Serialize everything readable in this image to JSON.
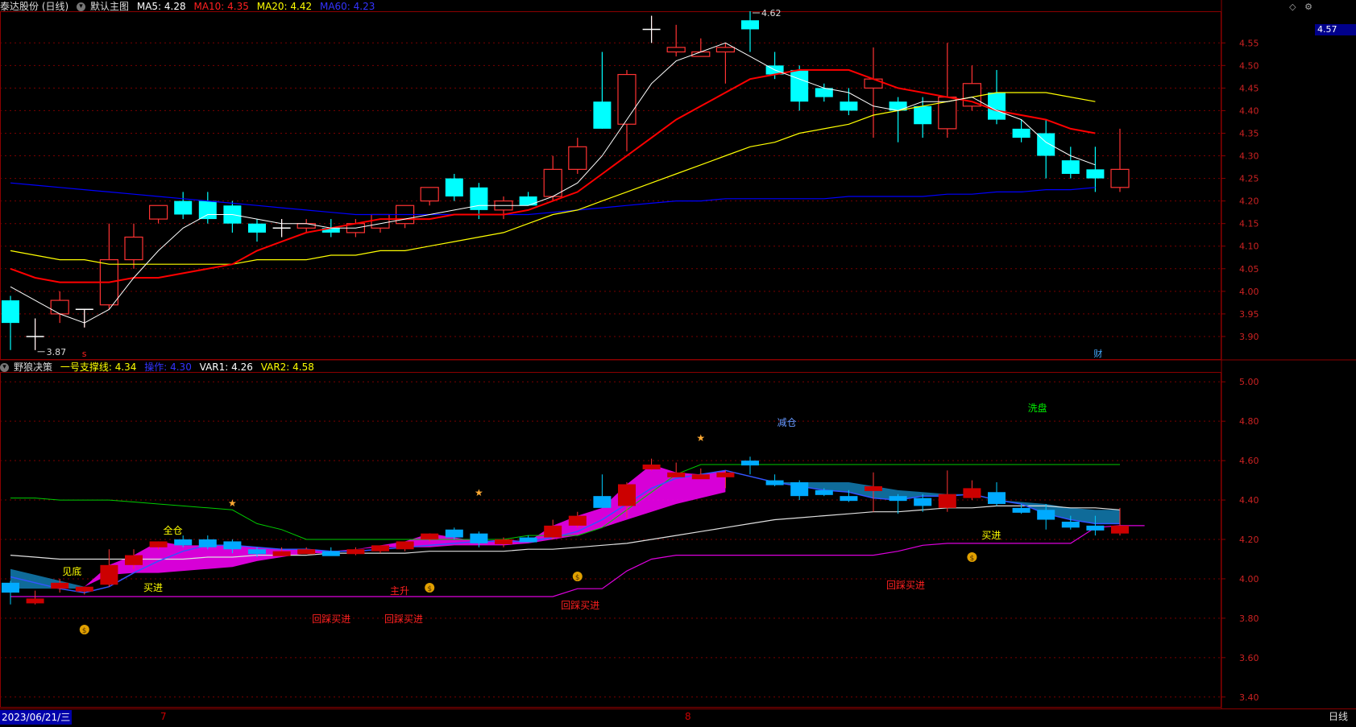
{
  "main_header": {
    "stock": "泰达股份 (日线)",
    "indicator": "默认主图",
    "ma5": "MA5: 4.28",
    "ma10": "MA10: 4.35",
    "ma20": "MA20: 4.42",
    "ma60": "MA60: 4.23"
  },
  "sub_header": {
    "indicator": "野狼决策",
    "support": "一号支撑线: 4.34",
    "op": "操作: 4.30",
    "var1": "VAR1: 4.26",
    "var2": "VAR2: 4.58"
  },
  "current_price_badge": "4.57",
  "high_label": "4.62",
  "low_label": "3.87",
  "marker_s": "s",
  "marker_cai": "财",
  "bottom": {
    "date": "2023/06/21/三",
    "month7": "7",
    "month8": "8",
    "period": "日线"
  },
  "colors": {
    "up": "#ff3333",
    "down": "#00ffff",
    "ma5": "#ffffff",
    "ma10": "#ff0000",
    "ma20": "#ffff00",
    "ma60": "#0000ff",
    "border": "#8b0000"
  },
  "chart_data": [
    {
      "type": "candlestick",
      "name": "main",
      "ylim": [
        3.85,
        4.62
      ],
      "y_ticks": [
        "4.55",
        "4.50",
        "4.45",
        "4.40",
        "4.35",
        "4.30",
        "4.25",
        "4.20",
        "4.15",
        "4.10",
        "4.05",
        "4.00",
        "3.95",
        "3.90"
      ],
      "candles": [
        {
          "o": 3.98,
          "h": 3.99,
          "l": 3.87,
          "c": 3.93
        },
        {
          "o": 3.9,
          "h": 3.94,
          "l": 3.87,
          "c": 3.9
        },
        {
          "o": 3.95,
          "h": 4.0,
          "l": 3.93,
          "c": 3.98
        },
        {
          "o": 3.96,
          "h": 3.96,
          "l": 3.92,
          "c": 3.96
        },
        {
          "o": 3.97,
          "h": 4.15,
          "l": 3.96,
          "c": 4.07
        },
        {
          "o": 4.07,
          "h": 4.15,
          "l": 4.05,
          "c": 4.12
        },
        {
          "o": 4.16,
          "h": 4.19,
          "l": 4.15,
          "c": 4.19
        },
        {
          "o": 4.2,
          "h": 4.22,
          "l": 4.16,
          "c": 4.17
        },
        {
          "o": 4.2,
          "h": 4.22,
          "l": 4.15,
          "c": 4.16
        },
        {
          "o": 4.19,
          "h": 4.2,
          "l": 4.13,
          "c": 4.15
        },
        {
          "o": 4.15,
          "h": 4.16,
          "l": 4.11,
          "c": 4.13
        },
        {
          "o": 4.14,
          "h": 4.16,
          "l": 4.12,
          "c": 4.14
        },
        {
          "o": 4.14,
          "h": 4.16,
          "l": 4.13,
          "c": 4.15
        },
        {
          "o": 4.14,
          "h": 4.16,
          "l": 4.12,
          "c": 4.13
        },
        {
          "o": 4.13,
          "h": 4.16,
          "l": 4.12,
          "c": 4.15
        },
        {
          "o": 4.14,
          "h": 4.17,
          "l": 4.13,
          "c": 4.17
        },
        {
          "o": 4.15,
          "h": 4.19,
          "l": 4.14,
          "c": 4.19
        },
        {
          "o": 4.2,
          "h": 4.23,
          "l": 4.19,
          "c": 4.23
        },
        {
          "o": 4.25,
          "h": 4.26,
          "l": 4.2,
          "c": 4.21
        },
        {
          "o": 4.23,
          "h": 4.24,
          "l": 4.16,
          "c": 4.18
        },
        {
          "o": 4.18,
          "h": 4.21,
          "l": 4.16,
          "c": 4.2
        },
        {
          "o": 4.21,
          "h": 4.22,
          "l": 4.19,
          "c": 4.19
        },
        {
          "o": 4.21,
          "h": 4.3,
          "l": 4.2,
          "c": 4.27
        },
        {
          "o": 4.27,
          "h": 4.34,
          "l": 4.26,
          "c": 4.32
        },
        {
          "o": 4.42,
          "h": 4.53,
          "l": 4.36,
          "c": 4.36
        },
        {
          "o": 4.37,
          "h": 4.49,
          "l": 4.31,
          "c": 4.48
        },
        {
          "o": 4.58,
          "h": 4.61,
          "l": 4.55,
          "c": 4.58
        },
        {
          "o": 4.53,
          "h": 4.59,
          "l": 4.52,
          "c": 4.54
        },
        {
          "o": 4.52,
          "h": 4.56,
          "l": 4.52,
          "c": 4.53
        },
        {
          "o": 4.53,
          "h": 4.55,
          "l": 4.46,
          "c": 4.54
        },
        {
          "o": 4.6,
          "h": 4.62,
          "l": 4.53,
          "c": 4.58
        },
        {
          "o": 4.5,
          "h": 4.53,
          "l": 4.47,
          "c": 4.48
        },
        {
          "o": 4.49,
          "h": 4.5,
          "l": 4.4,
          "c": 4.42
        },
        {
          "o": 4.45,
          "h": 4.46,
          "l": 4.42,
          "c": 4.43
        },
        {
          "o": 4.42,
          "h": 4.45,
          "l": 4.39,
          "c": 4.4
        },
        {
          "o": 4.45,
          "h": 4.54,
          "l": 4.34,
          "c": 4.47
        },
        {
          "o": 4.42,
          "h": 4.43,
          "l": 4.33,
          "c": 4.4
        },
        {
          "o": 4.41,
          "h": 4.43,
          "l": 4.34,
          "c": 4.37
        },
        {
          "o": 4.36,
          "h": 4.55,
          "l": 4.34,
          "c": 4.43
        },
        {
          "o": 4.41,
          "h": 4.5,
          "l": 4.4,
          "c": 4.46
        },
        {
          "o": 4.44,
          "h": 4.49,
          "l": 4.37,
          "c": 4.38
        },
        {
          "o": 4.36,
          "h": 4.38,
          "l": 4.33,
          "c": 4.34
        },
        {
          "o": 4.35,
          "h": 4.38,
          "l": 4.25,
          "c": 4.3
        },
        {
          "o": 4.29,
          "h": 4.32,
          "l": 4.25,
          "c": 4.26
        },
        {
          "o": 4.27,
          "h": 4.32,
          "l": 4.22,
          "c": 4.25
        },
        {
          "o": 4.23,
          "h": 4.36,
          "l": 4.22,
          "c": 4.27
        }
      ],
      "ma5": [
        4.01,
        3.98,
        3.95,
        3.93,
        3.96,
        4.03,
        4.09,
        4.14,
        4.17,
        4.17,
        4.16,
        4.15,
        4.15,
        4.14,
        4.14,
        4.15,
        4.16,
        4.17,
        4.18,
        4.19,
        4.19,
        4.19,
        4.21,
        4.24,
        4.3,
        4.38,
        4.46,
        4.51,
        4.53,
        4.55,
        4.52,
        4.49,
        4.47,
        4.45,
        4.44,
        4.41,
        4.4,
        4.42,
        4.42,
        4.43,
        4.4,
        4.38,
        4.33,
        4.3,
        4.28
      ],
      "ma10": [
        4.05,
        4.03,
        4.02,
        4.02,
        4.02,
        4.03,
        4.03,
        4.04,
        4.05,
        4.06,
        4.09,
        4.11,
        4.13,
        4.14,
        4.15,
        4.16,
        4.16,
        4.16,
        4.17,
        4.17,
        4.17,
        4.18,
        4.2,
        4.22,
        4.26,
        4.3,
        4.34,
        4.38,
        4.41,
        4.44,
        4.47,
        4.48,
        4.49,
        4.49,
        4.49,
        4.47,
        4.45,
        4.44,
        4.43,
        4.42,
        4.4,
        4.39,
        4.38,
        4.36,
        4.35
      ],
      "ma20": [
        4.09,
        4.08,
        4.07,
        4.07,
        4.06,
        4.06,
        4.06,
        4.06,
        4.06,
        4.06,
        4.07,
        4.07,
        4.07,
        4.08,
        4.08,
        4.09,
        4.09,
        4.1,
        4.11,
        4.12,
        4.13,
        4.15,
        4.17,
        4.18,
        4.2,
        4.22,
        4.24,
        4.26,
        4.28,
        4.3,
        4.32,
        4.33,
        4.35,
        4.36,
        4.37,
        4.39,
        4.4,
        4.41,
        4.42,
        4.43,
        4.44,
        4.44,
        4.44,
        4.43,
        4.42
      ],
      "ma60": [
        4.24,
        4.235,
        4.23,
        4.225,
        4.22,
        4.215,
        4.21,
        4.205,
        4.2,
        4.195,
        4.19,
        4.185,
        4.18,
        4.175,
        4.17,
        4.17,
        4.17,
        4.17,
        4.17,
        4.17,
        4.17,
        4.17,
        4.175,
        4.18,
        4.185,
        4.19,
        4.195,
        4.2,
        4.2,
        4.205,
        4.205,
        4.205,
        4.205,
        4.205,
        4.21,
        4.21,
        4.21,
        4.21,
        4.215,
        4.215,
        4.22,
        4.22,
        4.225,
        4.225,
        4.23
      ]
    },
    {
      "type": "indicator",
      "name": "sub",
      "ylim": [
        3.35,
        5.05
      ],
      "y_ticks": [
        "5.00",
        "4.80",
        "4.60",
        "4.40",
        "4.20",
        "4.00",
        "3.80",
        "3.60",
        "3.40"
      ],
      "green_line": [
        4.41,
        4.41,
        4.4,
        4.4,
        4.4,
        4.39,
        4.38,
        4.37,
        4.36,
        4.35,
        4.28,
        4.25,
        4.2,
        4.2,
        4.2,
        4.2,
        4.2,
        4.2,
        4.2,
        4.2,
        4.2,
        4.22,
        4.22,
        4.22,
        4.26,
        4.35,
        4.44,
        4.53,
        4.58,
        4.58,
        4.58,
        4.58,
        4.58,
        4.58,
        4.58,
        4.58,
        4.58,
        4.58,
        4.58,
        4.58,
        4.58,
        4.58,
        4.58,
        4.58,
        4.58,
        4.58
      ],
      "white_line": [
        4.12,
        4.11,
        4.1,
        4.1,
        4.1,
        4.1,
        4.1,
        4.1,
        4.11,
        4.11,
        4.12,
        4.12,
        4.12,
        4.13,
        4.13,
        4.13,
        4.13,
        4.14,
        4.14,
        4.14,
        4.14,
        4.15,
        4.15,
        4.16,
        4.17,
        4.18,
        4.2,
        4.22,
        4.24,
        4.26,
        4.28,
        4.3,
        4.31,
        4.32,
        4.33,
        4.34,
        4.34,
        4.35,
        4.36,
        4.36,
        4.37,
        4.37,
        4.37,
        4.36,
        4.36,
        4.35
      ],
      "magenta_line": [
        3.91,
        3.91,
        3.91,
        3.91,
        3.91,
        3.91,
        3.91,
        3.91,
        3.91,
        3.91,
        3.91,
        3.91,
        3.91,
        3.91,
        3.91,
        3.91,
        3.91,
        3.91,
        3.91,
        3.91,
        3.91,
        3.91,
        3.91,
        3.95,
        3.95,
        4.04,
        4.1,
        4.12,
        4.12,
        4.12,
        4.12,
        4.12,
        4.12,
        4.12,
        4.12,
        4.12,
        4.14,
        4.17,
        4.18,
        4.18,
        4.18,
        4.18,
        4.18,
        4.18,
        4.26,
        4.27,
        4.27
      ],
      "labels_yellow": [
        "见底",
        "买进",
        "全仓",
        "买进"
      ],
      "labels_red": [
        "回踩买进",
        "回踩买进",
        "主升",
        "回踩买进",
        "回踩买进"
      ],
      "label_blue": "减仓",
      "label_green": "洗盘"
    }
  ]
}
